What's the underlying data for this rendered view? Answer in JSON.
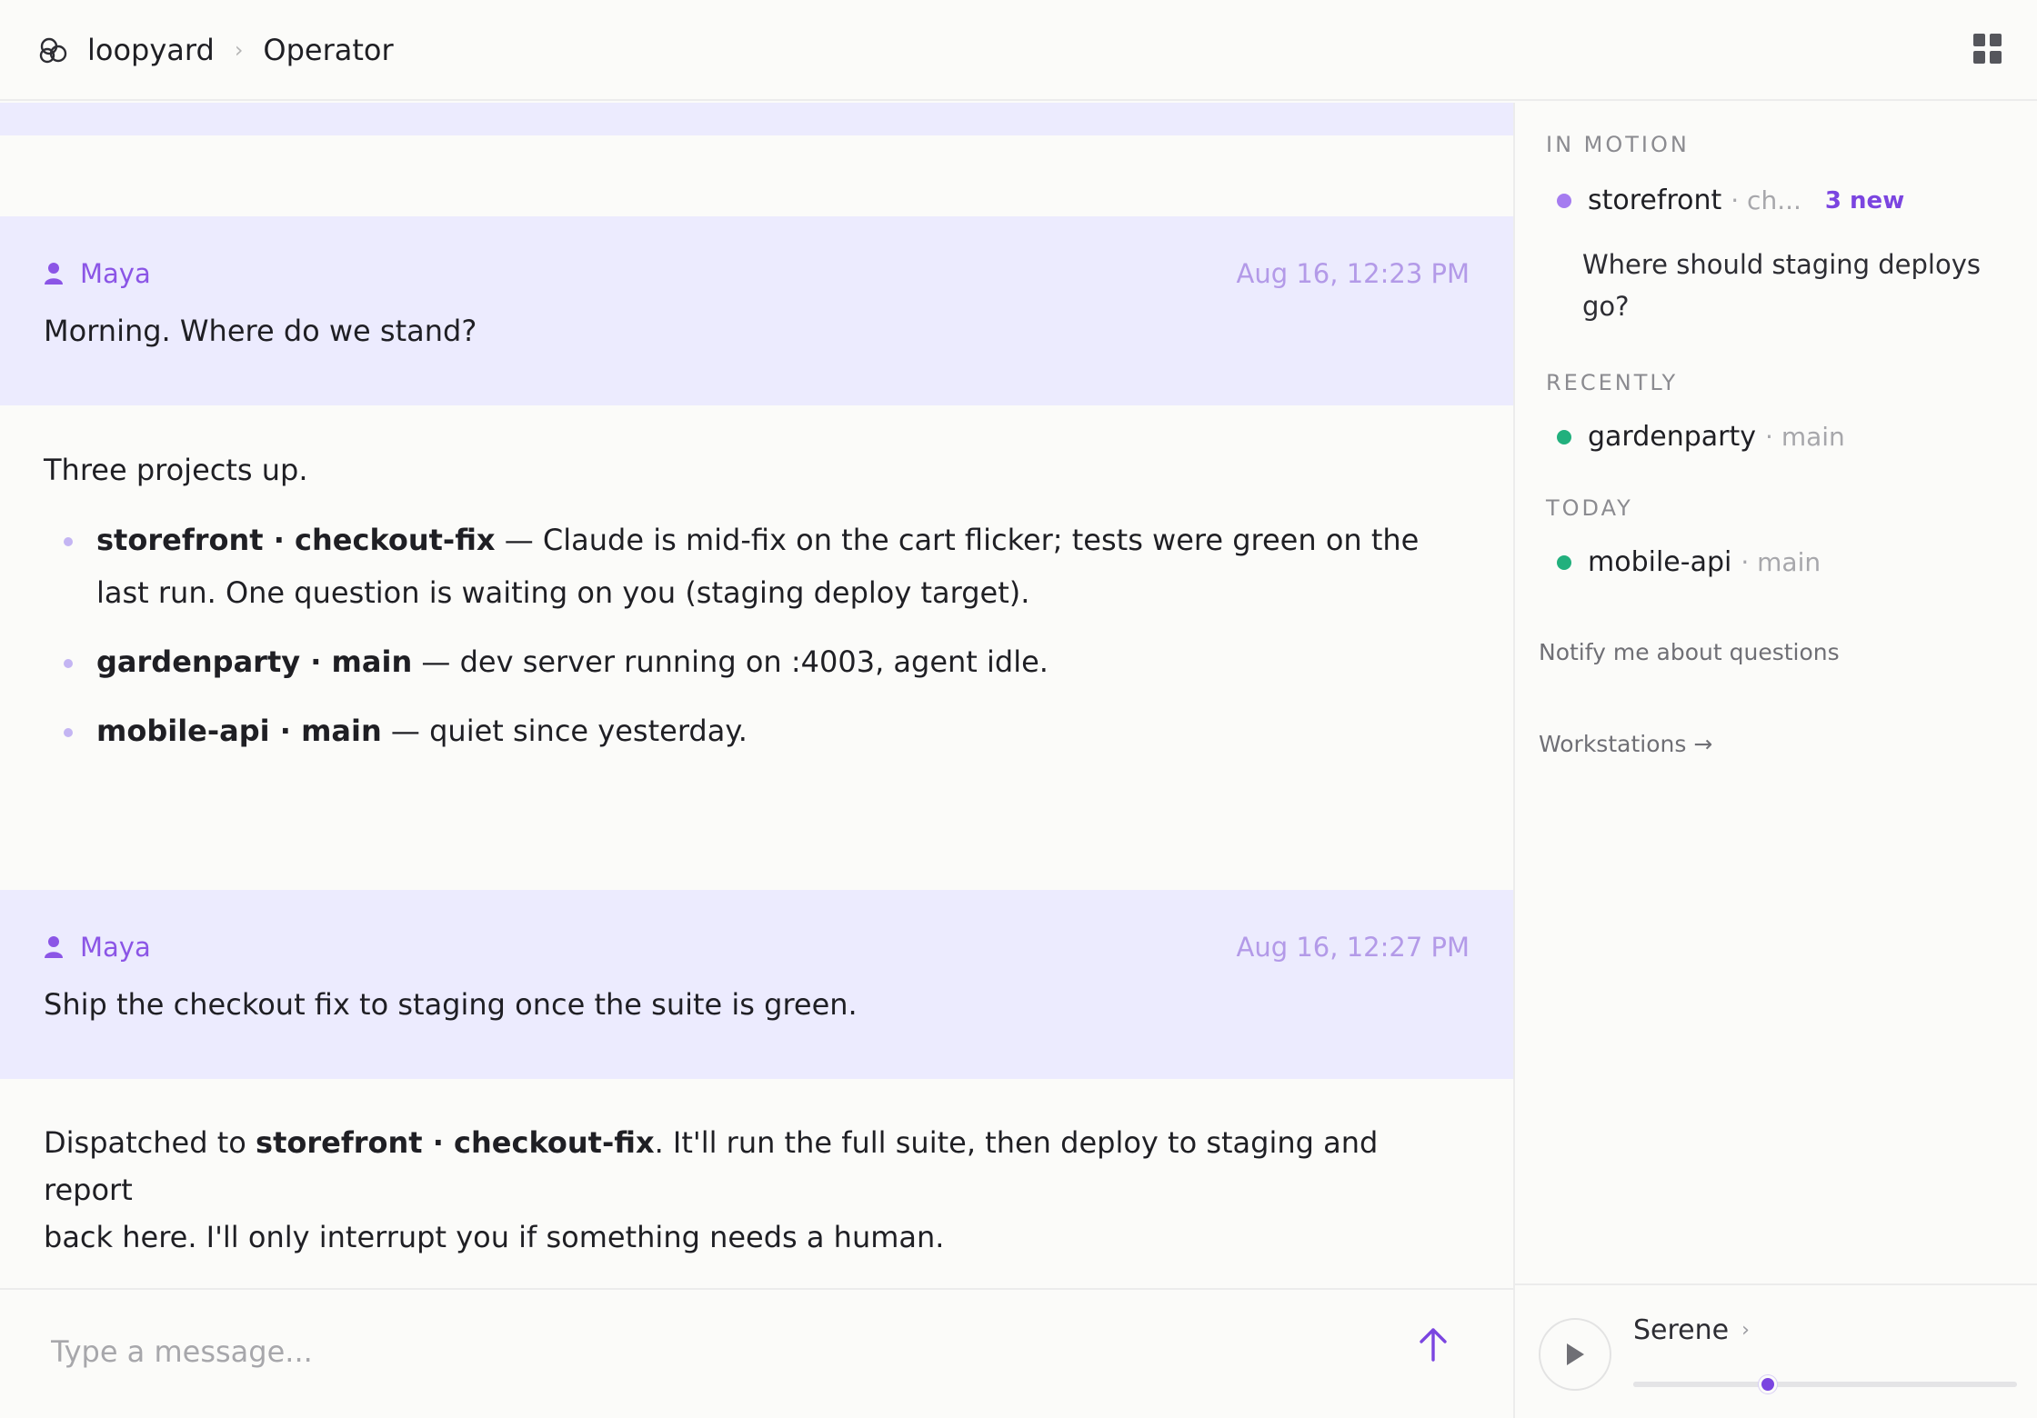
{
  "header": {
    "app_name": "loopyard",
    "separator": "›",
    "page_title": "Operator"
  },
  "messages": {
    "first": {
      "author": "Maya",
      "timestamp": "Aug 16, 12:23 PM",
      "text": "Morning. Where do we stand?"
    },
    "reply_1": {
      "intro": "Three projects up.",
      "items": [
        {
          "bold": "storefront · checkout-fix",
          "text": " — Claude is mid-fix on the cart flicker; tests were green on the",
          "text2": "last run. One question is waiting on you (staging deploy target)."
        },
        {
          "bold": "gardenparty · main",
          "text": " — dev server running on :4003, agent idle."
        },
        {
          "bold": "mobile-api · main",
          "text": " — quiet since yesterday."
        }
      ]
    },
    "second": {
      "author": "Maya",
      "timestamp": "Aug 16, 12:27 PM",
      "text": "Ship the checkout fix to staging once the suite is green."
    },
    "reply_2": {
      "pre": "Dispatched to ",
      "bold": "storefront · checkout-fix",
      "post": ". It'll run the full suite, then deploy to staging and report",
      "line2": "back here. I'll only interrupt you if something needs a human."
    }
  },
  "composer": {
    "placeholder": "Type a message..."
  },
  "sidebar": {
    "in_motion": {
      "title": "IN MOTION",
      "project": {
        "name": "storefront",
        "branch": "· ch...",
        "badge": "3 new",
        "status_color": "#a57cf0"
      },
      "question": "Where should staging deploys go?"
    },
    "recently": {
      "title": "RECENTLY",
      "project": {
        "name": "gardenparty",
        "branch": "· main",
        "status_color": "#22b07d"
      }
    },
    "today": {
      "title": "TODAY",
      "project": {
        "name": "mobile-api",
        "branch": "· main",
        "status_color": "#22b07d"
      }
    },
    "notify_label": "Notify me about questions",
    "workstations_label": "Workstations →"
  },
  "player": {
    "track_name": "Serene",
    "chevron": "›",
    "progress": 0.35
  },
  "colors": {
    "accent": "#7b45e0",
    "user_bubble": "#ecebfe",
    "author": "#8b55e6",
    "timestamp": "#b39ae8"
  }
}
